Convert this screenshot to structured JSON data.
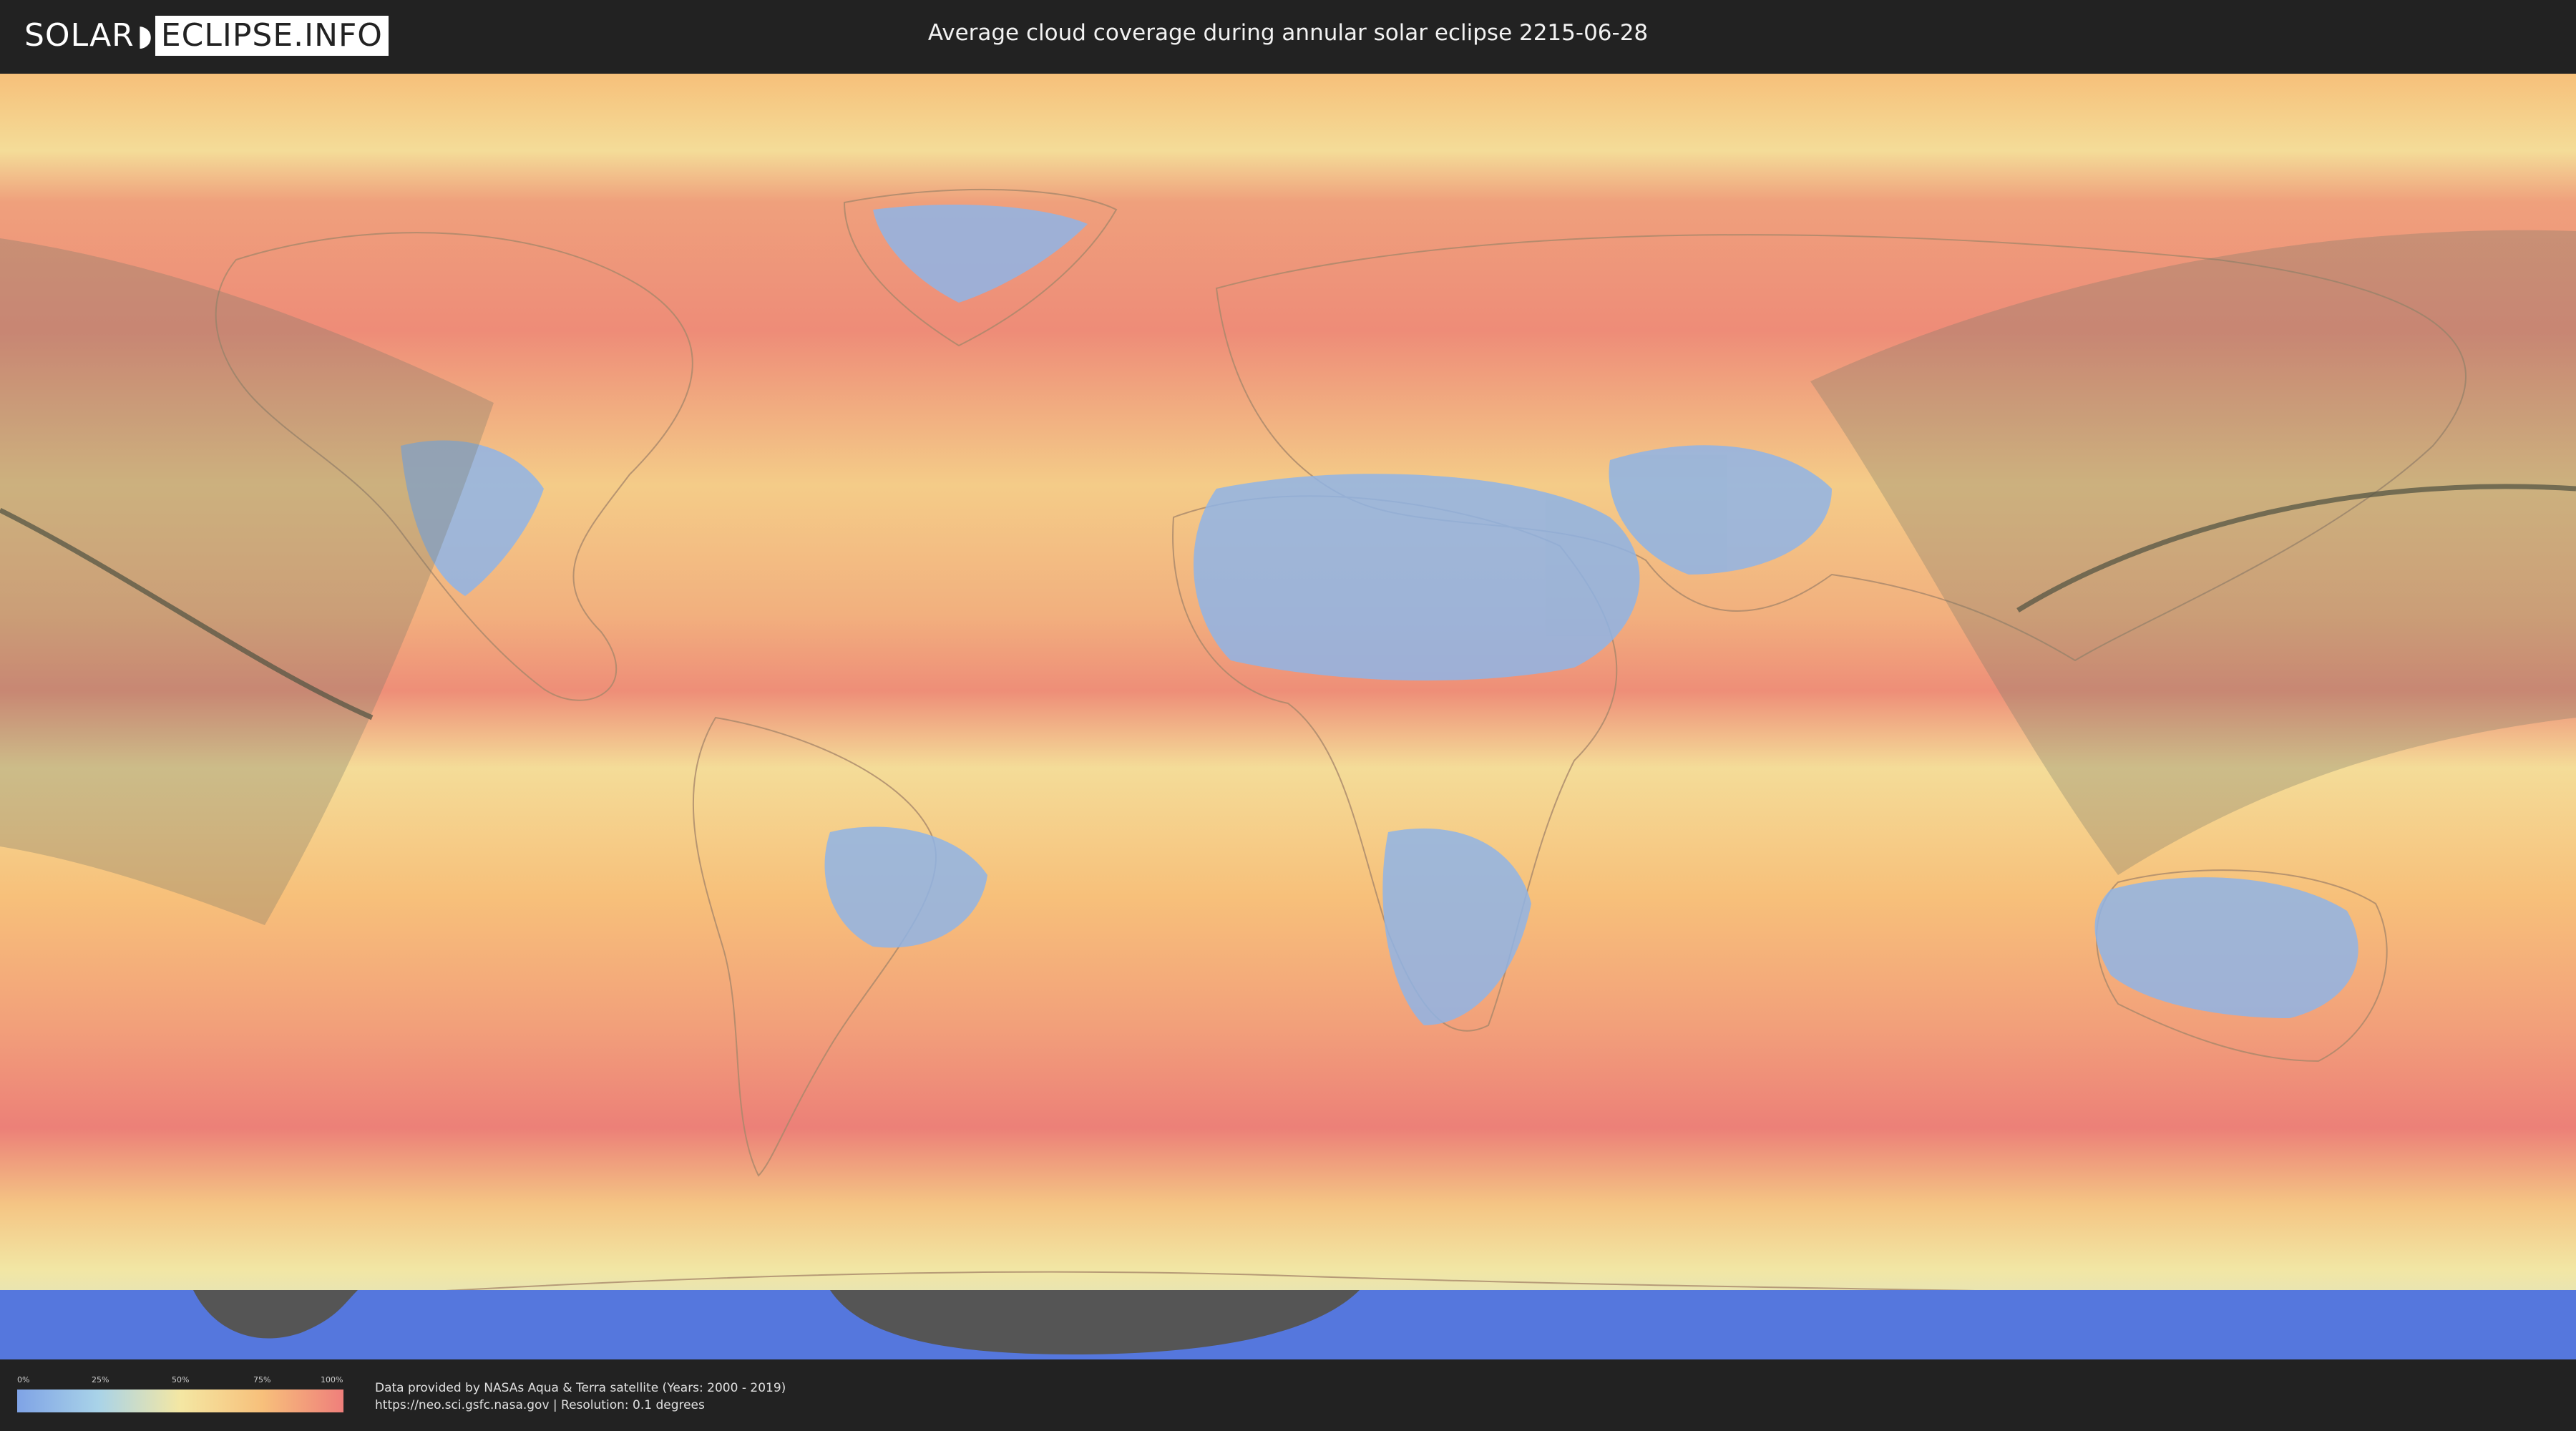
{
  "logo": {
    "part1": "SOLAR",
    "part2": "ECLIPSE.INFO"
  },
  "header": {
    "title": "Average cloud coverage during annular solar eclipse 2215-06-28"
  },
  "legend": {
    "ticks": [
      "0%",
      "25%",
      "50%",
      "75%",
      "100%"
    ],
    "gradient_colors": [
      "#7fa3e6",
      "#a9d3e8",
      "#f4e7a3",
      "#f7c07b",
      "#ef7f7b"
    ]
  },
  "credits": {
    "line1": "Data provided by NASAs Aqua & Terra satellite (Years: 2000 - 2019)",
    "line2": "https://neo.sci.gsfc.nasa.gov | Resolution: 0.1 degrees"
  },
  "map": {
    "colors": {
      "cloud_high": "#ee8278",
      "cloud_mid": "#f6c07a",
      "cloud_low": "#f4e4a0",
      "clear": "#8fb4e6",
      "antarctic_blue": "#5577dd",
      "eclipse_shadow": "#8a8a6a",
      "central_line": "#4a4a4a"
    }
  }
}
